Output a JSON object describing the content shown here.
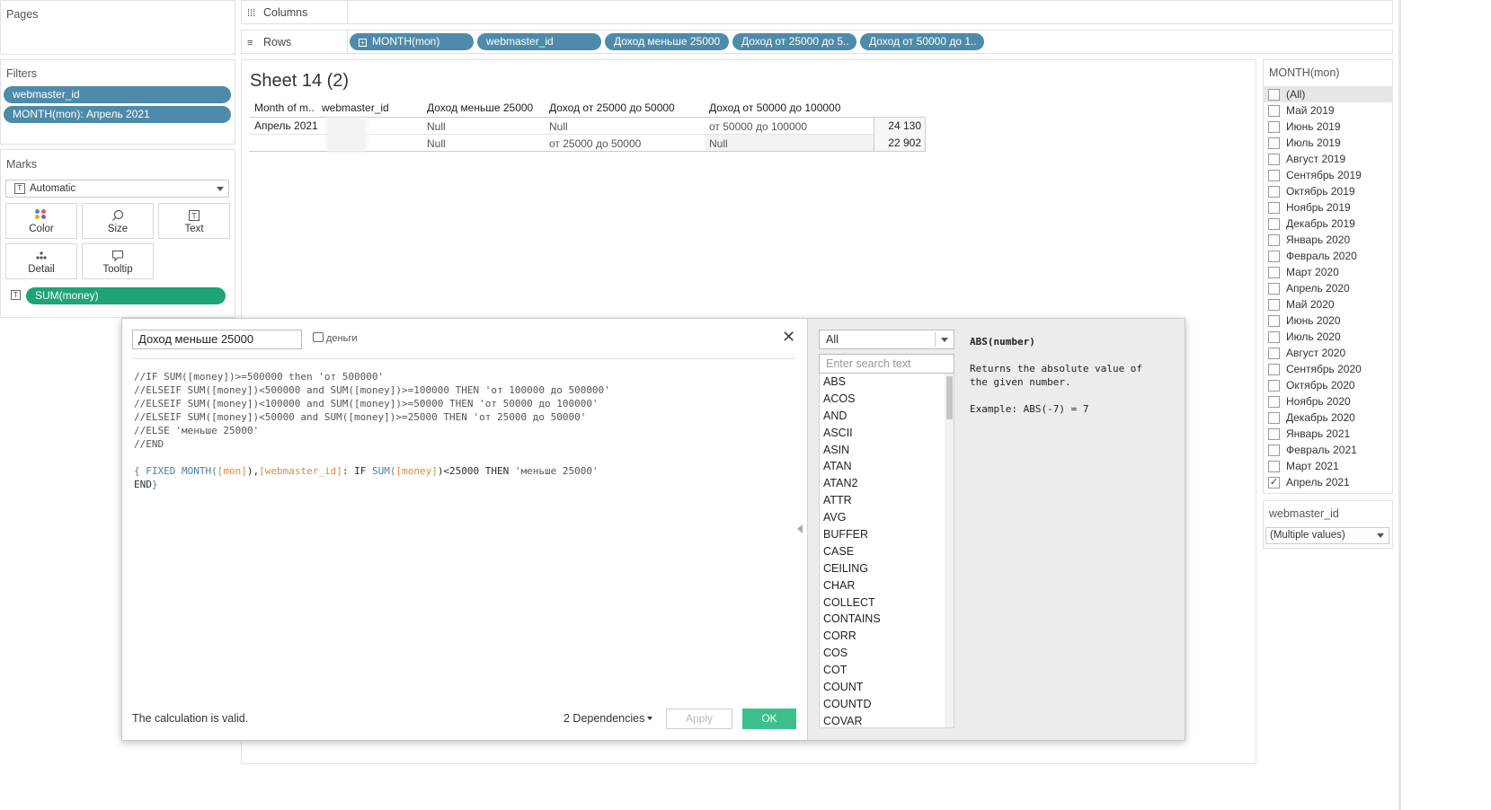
{
  "pages": {
    "title": "Pages"
  },
  "filters": {
    "title": "Filters",
    "pills": [
      "webmaster_id",
      "MONTH(mon): Апрель 2021"
    ]
  },
  "marks": {
    "title": "Marks",
    "type": "Automatic",
    "buttons": {
      "color": "Color",
      "size": "Size",
      "text": "Text",
      "detail": "Detail",
      "tooltip": "Tooltip"
    },
    "field": "SUM(money)"
  },
  "shelves": {
    "columns_label": "Columns",
    "rows_label": "Rows",
    "rows_pills": [
      "MONTH(mon)",
      "webmaster_id",
      "Доход меньше 25000",
      "Доход от 25000 до 5..",
      "Доход от 50000 до 1.."
    ]
  },
  "sheet": {
    "title": "Sheet 14 (2)",
    "headers": [
      "Month of m..",
      "webmaster_id",
      "Доход меньше 25000",
      "Доход от 25000 до 50000",
      "Доход от 50000 до 100000"
    ],
    "month": "Апрель 2021",
    "rows": [
      {
        "less25": "Null",
        "r25_50": "Null",
        "r50_100": "от 50000 до 100000",
        "value": "24 130"
      },
      {
        "less25": "Null",
        "r25_50": "от 25000 до 50000",
        "r50_100": "Null",
        "value": "22 902"
      }
    ]
  },
  "month_filter": {
    "title": "MONTH(mon)",
    "items": [
      {
        "label": "(All)",
        "checked": false
      },
      {
        "label": "Май 2019",
        "checked": false
      },
      {
        "label": "Июнь 2019",
        "checked": false
      },
      {
        "label": "Июль 2019",
        "checked": false
      },
      {
        "label": "Август 2019",
        "checked": false
      },
      {
        "label": "Сентябрь 2019",
        "checked": false
      },
      {
        "label": "Октябрь 2019",
        "checked": false
      },
      {
        "label": "Ноябрь 2019",
        "checked": false
      },
      {
        "label": "Декабрь 2019",
        "checked": false
      },
      {
        "label": "Январь 2020",
        "checked": false
      },
      {
        "label": "Февраль 2020",
        "checked": false
      },
      {
        "label": "Март 2020",
        "checked": false
      },
      {
        "label": "Апрель 2020",
        "checked": false
      },
      {
        "label": "Май 2020",
        "checked": false
      },
      {
        "label": "Июнь 2020",
        "checked": false
      },
      {
        "label": "Июль 2020",
        "checked": false
      },
      {
        "label": "Август 2020",
        "checked": false
      },
      {
        "label": "Сентябрь 2020",
        "checked": false
      },
      {
        "label": "Октябрь 2020",
        "checked": false
      },
      {
        "label": "Ноябрь 2020",
        "checked": false
      },
      {
        "label": "Декабрь 2020",
        "checked": false
      },
      {
        "label": "Январь 2021",
        "checked": false
      },
      {
        "label": "Февраль 2021",
        "checked": false
      },
      {
        "label": "Март 2021",
        "checked": false
      },
      {
        "label": "Апрель 2021",
        "checked": true
      }
    ]
  },
  "webmaster_filter": {
    "title": "webmaster_id",
    "value": "(Multiple values)"
  },
  "calc": {
    "name": "Доход меньше 25000",
    "datasource": "деньги",
    "comment_lines": [
      "//IF SUM([money])>=500000 then 'от 500000'",
      "//ELSEIF SUM([money])<500000 and SUM([money])>=100000 THEN 'от 100000 до 500000'",
      "//ELSEIF SUM([money])<100000 and SUM([money])>=50000 THEN 'от 50000 до 100000'",
      "//ELSEIF SUM([money])<50000 and SUM([money])>=25000 THEN 'от 25000 до 50000'",
      "//ELSE 'меньше 25000'",
      "//END"
    ],
    "code": {
      "open": "{ FIXED ",
      "month_fn": "MONTH(",
      "mon": "[mon]",
      "mid": "),",
      "wid": "[webmaster_id]",
      "colon": ": IF ",
      "sum": "SUM(",
      "money": "[money]",
      "rest": ")<25000 THEN ",
      "lit": "'меньше 25000'",
      "end": "END",
      "close": "}"
    },
    "status": "The calculation is valid.",
    "dependencies": "2 Dependencies",
    "apply": "Apply",
    "ok": "OK",
    "func_category": "All",
    "search_placeholder": "Enter search text",
    "functions": [
      "ABS",
      "ACOS",
      "AND",
      "ASCII",
      "ASIN",
      "ATAN",
      "ATAN2",
      "ATTR",
      "AVG",
      "BUFFER",
      "CASE",
      "CEILING",
      "CHAR",
      "COLLECT",
      "CONTAINS",
      "CORR",
      "COS",
      "COT",
      "COUNT",
      "COUNTD",
      "COVAR"
    ],
    "help_signature": "ABS(number)",
    "help_line1": "Returns the absolute value of",
    "help_line2": "the given number.",
    "help_example": "Example: ABS(-7) = 7"
  },
  "colors": {
    "pill_blue": "#4e8bab",
    "pill_green": "#1fa37a",
    "ok_green": "#3cc08e"
  }
}
